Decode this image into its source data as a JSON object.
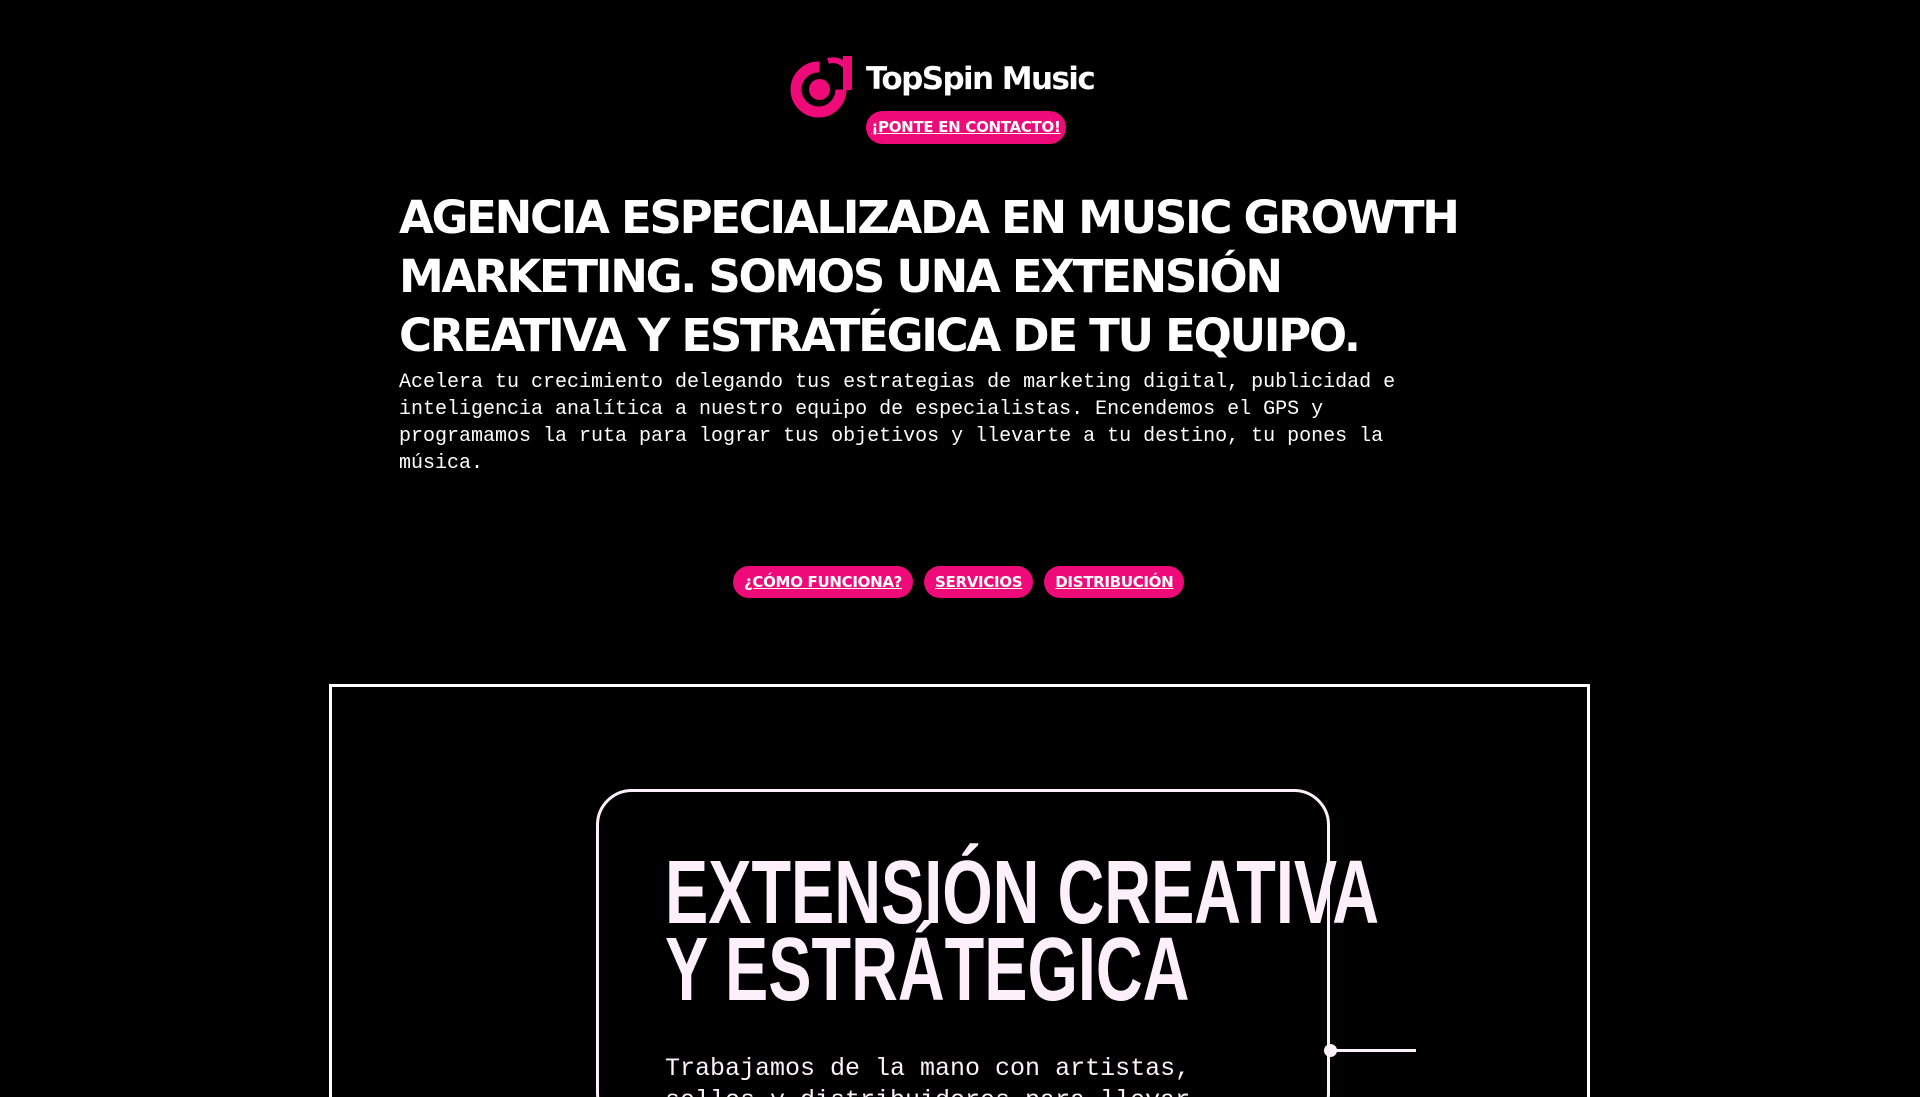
{
  "header": {
    "brand_name": "TopSpin Music",
    "logo_icon": "topspin-logo-icon",
    "contact_button": "¡PONTE EN CONTACTO!"
  },
  "hero": {
    "headline": "AGENCIA ESPECIALIZADA EN MUSIC GROWTH MARKETING. SOMOS UNA EXTENSIÓN CREATIVA Y ESTRATÉGICA DE TU EQUIPO.",
    "intro": "Acelera tu crecimiento delegando tus estrategias de marketing digital, publicidad e inteligencia analítica a nuestro equipo de especialistas. Encendemos el GPS y programamos la ruta para lograr tus objetivos y llevarte a tu destino, tu pones la música."
  },
  "nav": {
    "items": [
      {
        "label": "¿CÓMO FUNCIONA?"
      },
      {
        "label": "SERVICIOS"
      },
      {
        "label": "DISTRIBUCIÓN"
      }
    ]
  },
  "feature_card": {
    "title_line1": "EXTENSIÓN CREATIVA",
    "title_line2": "Y ESTRÁTEGICA",
    "text": "Trabajamos de la mano con artistas, sellos y distribuidores para llevar"
  },
  "colors": {
    "background": "#000000",
    "accent": "#ee0a78",
    "text": "#ffffff",
    "card_text": "#fdf0fa"
  }
}
